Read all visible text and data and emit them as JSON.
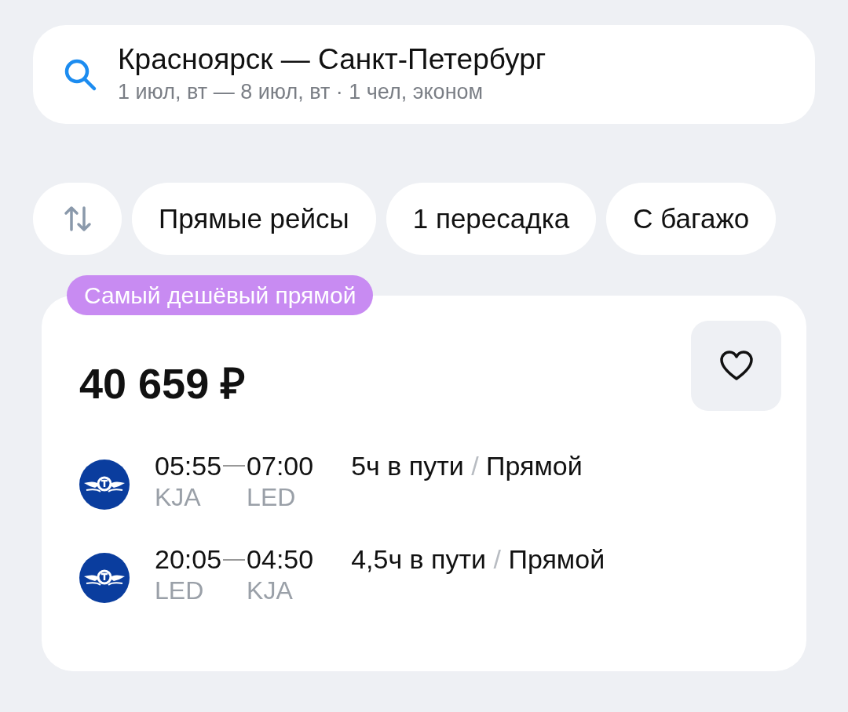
{
  "search": {
    "title": "Красноярск — Санкт-Петербург",
    "subtitle": "1 июл, вт — 8 июл, вт · 1 чел, эконом"
  },
  "filters": [
    {
      "label": "Прямые рейсы",
      "selected": false
    },
    {
      "label": "1 пересадка",
      "selected": false
    },
    {
      "label": "С багажо",
      "selected": false
    }
  ],
  "offer": {
    "badge": "Самый дешёвый прямой",
    "price": "40 659 ₽",
    "favorite": false,
    "flights": [
      {
        "dep_time": "05:55",
        "arr_time": "07:00",
        "dep_code": "KJA",
        "arr_code": "LED",
        "duration": "5ч в пути",
        "separator": "/",
        "type": "Прямой"
      },
      {
        "dep_time": "20:05",
        "arr_time": "04:50",
        "dep_code": "LED",
        "arr_code": "KJA",
        "duration": "4,5ч в пути",
        "separator": "/",
        "type": "Прямой"
      }
    ]
  }
}
